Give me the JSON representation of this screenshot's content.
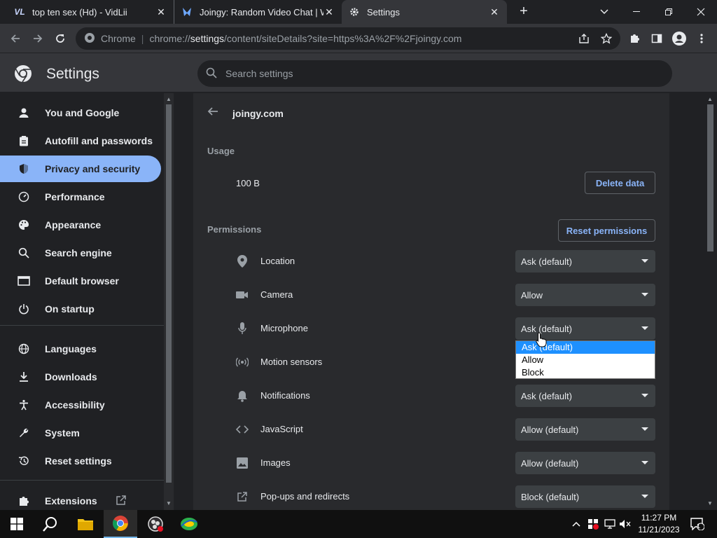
{
  "browser": {
    "tabs": [
      {
        "title": "top ten sex (Hd) - VidLii",
        "favicon": "vidlii-icon"
      },
      {
        "title": "Joingy: Random Video Chat | We",
        "favicon": "joingy-icon"
      },
      {
        "title": "Settings",
        "favicon": "gear-icon"
      }
    ],
    "omnibox": {
      "site_label": "Chrome",
      "url_prefix": "chrome://",
      "url_host": "settings",
      "url_rest": "/content/siteDetails?site=https%3A%2F%2Fjoingy.com"
    }
  },
  "settings": {
    "title": "Settings",
    "search_placeholder": "Search settings",
    "sidebar": [
      {
        "label": "You and Google",
        "icon": "person-icon"
      },
      {
        "label": "Autofill and passwords",
        "icon": "clipboard-icon"
      },
      {
        "label": "Privacy and security",
        "icon": "shield-icon",
        "active": true
      },
      {
        "label": "Performance",
        "icon": "speedometer-icon"
      },
      {
        "label": "Appearance",
        "icon": "palette-icon"
      },
      {
        "label": "Search engine",
        "icon": "search-icon"
      },
      {
        "label": "Default browser",
        "icon": "browser-icon"
      },
      {
        "label": "On startup",
        "icon": "power-icon"
      },
      {
        "label": "Languages",
        "icon": "globe-icon"
      },
      {
        "label": "Downloads",
        "icon": "download-icon"
      },
      {
        "label": "Accessibility",
        "icon": "accessibility-icon"
      },
      {
        "label": "System",
        "icon": "wrench-icon"
      },
      {
        "label": "Reset settings",
        "icon": "history-icon"
      },
      {
        "label": "Extensions",
        "icon": "puzzle-icon"
      }
    ],
    "site": {
      "name": "joingy.com",
      "usage_label": "Usage",
      "usage_value": "100 B",
      "delete_button": "Delete data",
      "permissions_label": "Permissions",
      "reset_button": "Reset permissions",
      "permissions": [
        {
          "label": "Location",
          "value": "Ask (default)",
          "icon": "location-pin-icon"
        },
        {
          "label": "Camera",
          "value": "Allow",
          "icon": "camera-icon"
        },
        {
          "label": "Microphone",
          "value": "Ask (default)",
          "icon": "microphone-icon"
        },
        {
          "label": "Motion sensors",
          "value": "Ask (default)",
          "icon": "motion-sensor-icon"
        },
        {
          "label": "Notifications",
          "value": "Ask (default)",
          "icon": "bell-icon"
        },
        {
          "label": "JavaScript",
          "value": "Allow (default)",
          "icon": "code-icon"
        },
        {
          "label": "Images",
          "value": "Allow (default)",
          "icon": "image-icon"
        },
        {
          "label": "Pop-ups and redirects",
          "value": "Block (default)",
          "icon": "open-in-new-icon"
        }
      ],
      "dropdown_options": [
        "Ask (default)",
        "Allow",
        "Block"
      ]
    }
  },
  "taskbar": {
    "time": "11:27 PM",
    "date": "11/21/2023",
    "notification_count": "1"
  },
  "colors": {
    "accent": "#8ab4f8",
    "background": "#202124",
    "card": "#292a2d"
  }
}
